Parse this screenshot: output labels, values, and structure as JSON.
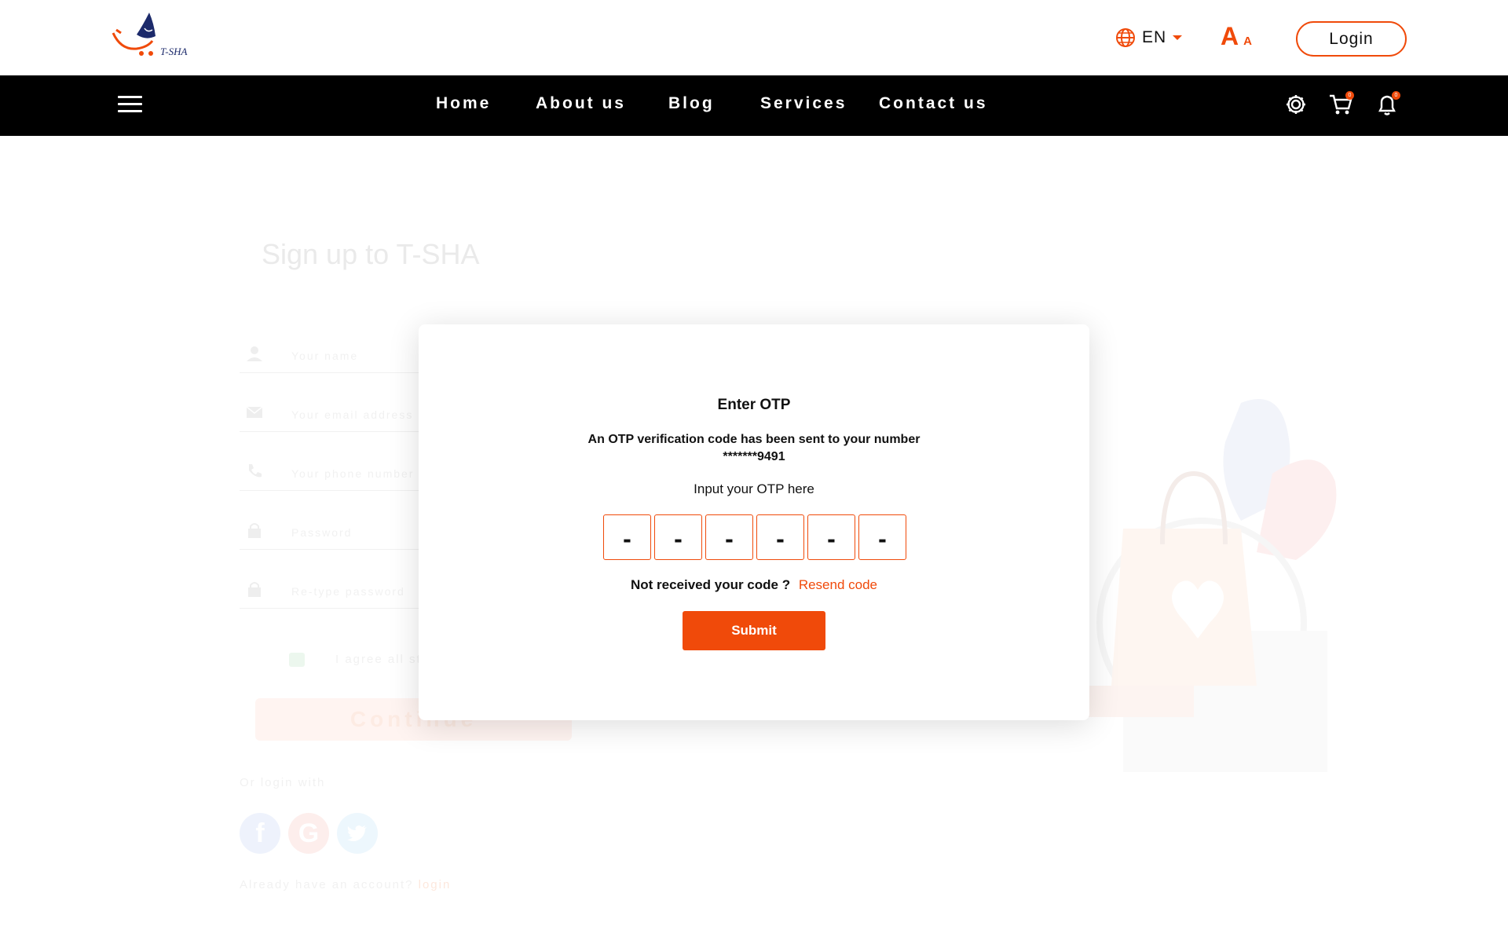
{
  "brand": {
    "logo_text": "T-SHA",
    "accent": "#f04a0a",
    "navy": "#1c2a6b"
  },
  "header": {
    "language": "EN",
    "font_size_large": "A",
    "font_size_small": "A",
    "login_label": "Login"
  },
  "nav": {
    "items": [
      "Home",
      "About us",
      "Blog",
      "Services",
      "Contact us"
    ],
    "cart_count": "0",
    "notification_count": "0"
  },
  "signup_form": {
    "title": "Sign up to T-SHA",
    "fields": [
      {
        "icon": "person-icon",
        "placeholder": "Your name"
      },
      {
        "icon": "mail-icon",
        "placeholder": "Your email address"
      },
      {
        "icon": "phone-icon",
        "placeholder": "Your phone number"
      },
      {
        "icon": "lock-icon",
        "placeholder": "Password"
      },
      {
        "icon": "lock-icon",
        "placeholder": "Re-type password"
      }
    ],
    "agree_text": "I agree all st",
    "continue_label": "Continue",
    "or_login_with": "Or login with",
    "social": [
      {
        "icon": "facebook-icon",
        "letter": "f",
        "color": "#e8eefb"
      },
      {
        "icon": "google-icon",
        "letter": "G",
        "color": "#fde8e6"
      },
      {
        "icon": "twitter-icon",
        "letter": "",
        "color": "#e7f4fc"
      }
    ],
    "already_text": "Already have an account?",
    "login_link": "login"
  },
  "otp_modal": {
    "title": "Enter OTP",
    "message_line1": "An OTP verification code has been sent to your number",
    "message_line2": "*******9491",
    "input_label": "Input your OTP here",
    "digits": [
      "-",
      "-",
      "-",
      "-",
      "-",
      "-"
    ],
    "not_received": "Not received your code ?",
    "resend_label": "Resend code",
    "submit_label": "Submit"
  }
}
